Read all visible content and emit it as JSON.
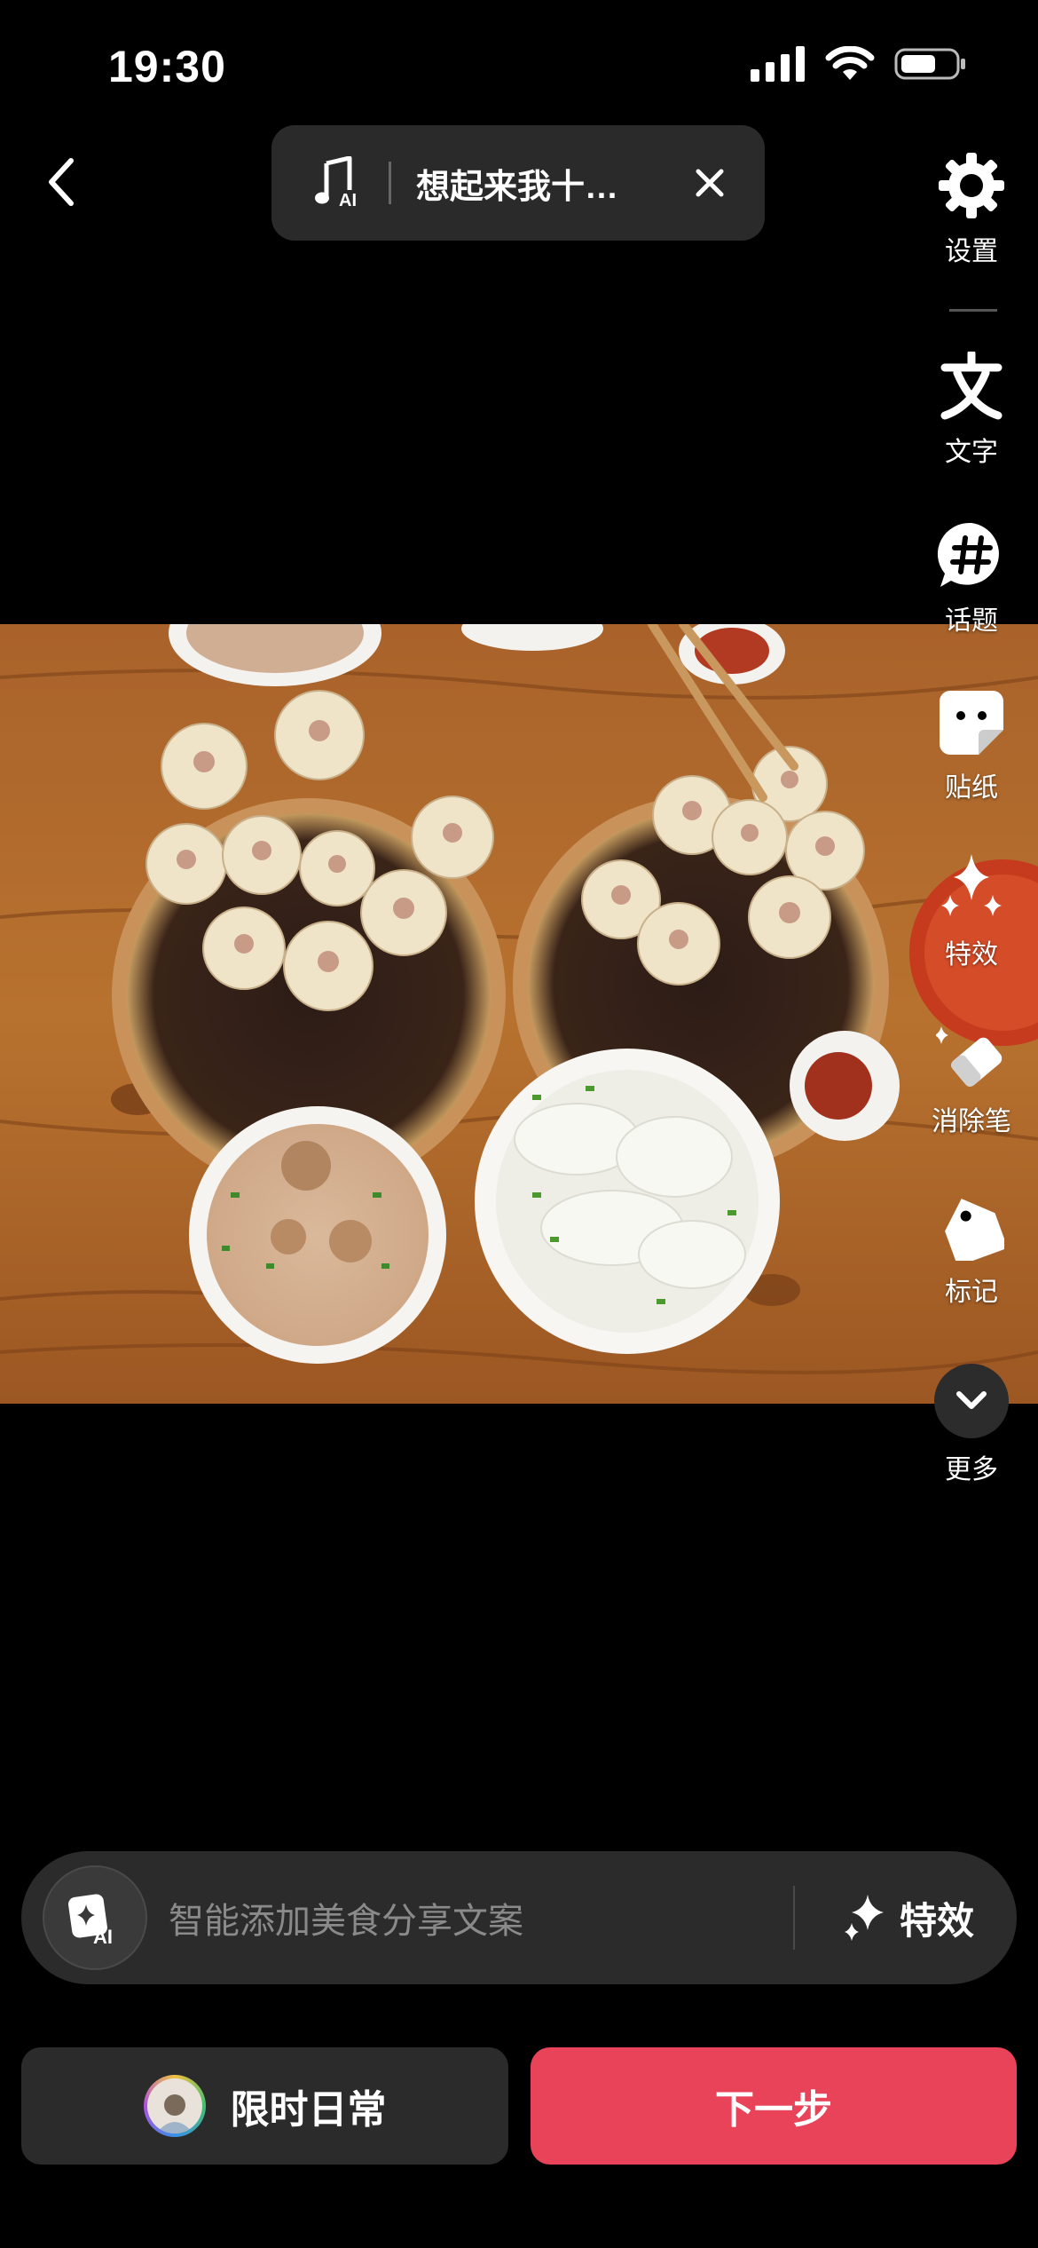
{
  "status_bar": {
    "time": "19:30"
  },
  "music": {
    "title": "想起来我十…"
  },
  "tools": [
    {
      "label": "设置",
      "icon": "gear-icon"
    },
    {
      "label": "文字",
      "icon": "text-icon"
    },
    {
      "label": "话题",
      "icon": "hashtag-icon"
    },
    {
      "label": "贴纸",
      "icon": "sticker-icon"
    },
    {
      "label": "特效",
      "icon": "sparkle-icon"
    },
    {
      "label": "消除笔",
      "icon": "eraser-icon"
    },
    {
      "label": "标记",
      "icon": "tag-icon"
    },
    {
      "label": "更多",
      "icon": "chevron-down-icon"
    }
  ],
  "ai_bar": {
    "placeholder": "智能添加美食分享文案",
    "effect_label": "特效"
  },
  "bottom": {
    "daily_label": "限时日常",
    "next_label": "下一步"
  },
  "colors": {
    "accent": "#e84359",
    "surface": "#2b2b2b",
    "background": "#000000"
  }
}
